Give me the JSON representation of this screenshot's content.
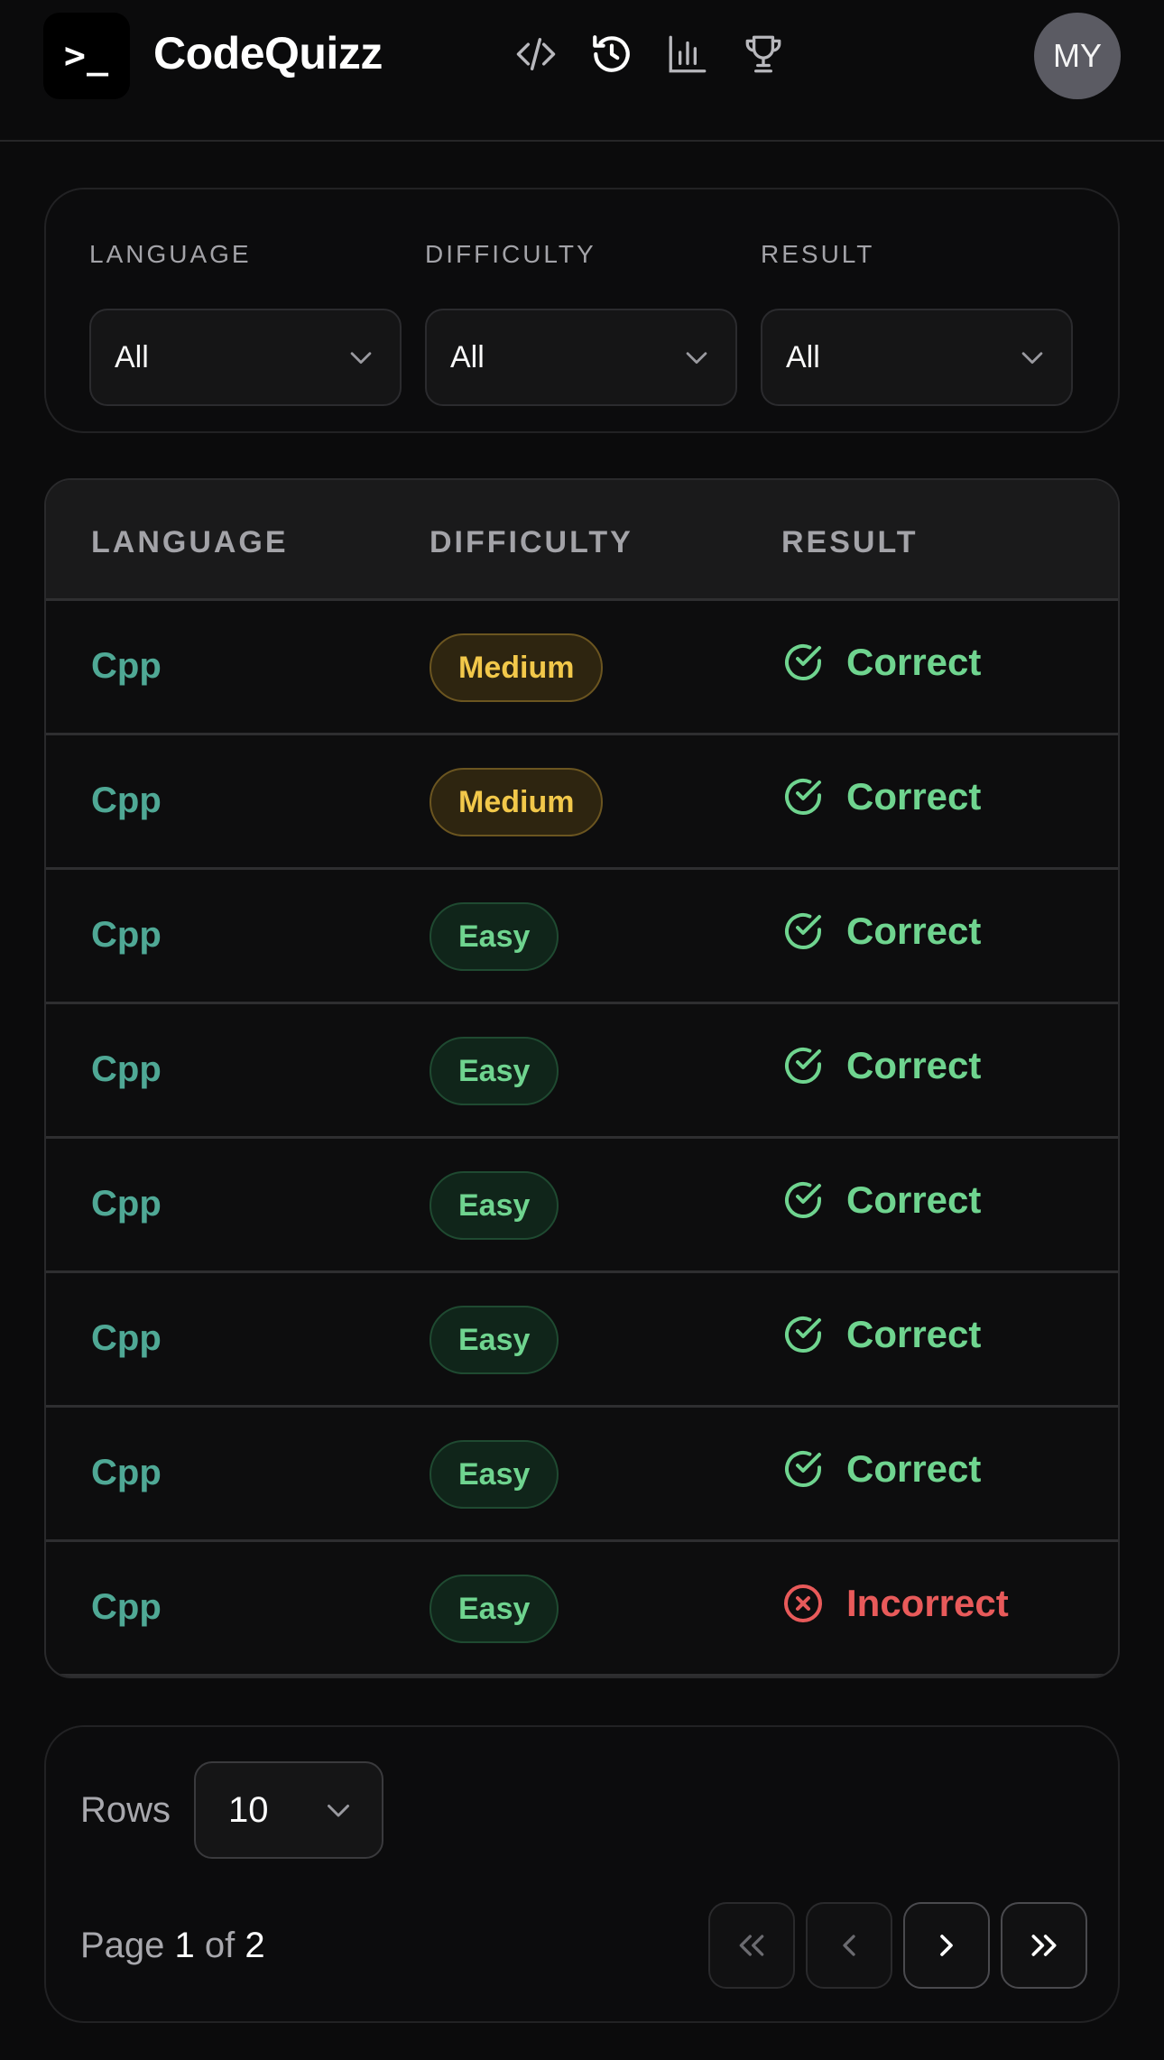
{
  "header": {
    "logo_text": ">_",
    "title": "CodeQuizz",
    "nav_icons": [
      "code-icon",
      "history-icon",
      "bar-chart-icon",
      "trophy-icon"
    ],
    "avatar_initials": "MY"
  },
  "filters": {
    "language": {
      "label": "LANGUAGE",
      "value": "All"
    },
    "difficulty": {
      "label": "DIFFICULTY",
      "value": "All"
    },
    "result": {
      "label": "RESULT",
      "value": "All"
    }
  },
  "table": {
    "columns": [
      "LANGUAGE",
      "DIFFICULTY",
      "RESULT"
    ],
    "rows": [
      {
        "language": "Cpp",
        "difficulty": "Medium",
        "result": "Correct"
      },
      {
        "language": "Cpp",
        "difficulty": "Medium",
        "result": "Correct"
      },
      {
        "language": "Cpp",
        "difficulty": "Easy",
        "result": "Correct"
      },
      {
        "language": "Cpp",
        "difficulty": "Easy",
        "result": "Correct"
      },
      {
        "language": "Cpp",
        "difficulty": "Easy",
        "result": "Correct"
      },
      {
        "language": "Cpp",
        "difficulty": "Easy",
        "result": "Correct"
      },
      {
        "language": "Cpp",
        "difficulty": "Easy",
        "result": "Correct"
      },
      {
        "language": "Cpp",
        "difficulty": "Easy",
        "result": "Incorrect"
      }
    ]
  },
  "pagination": {
    "rows_label": "Rows",
    "rows_value": "10",
    "page_word": "Page",
    "of_word": "of",
    "current_page": "1",
    "total_pages": "2"
  },
  "colors": {
    "background": "#0b0b0c",
    "language_text": "#4fa895",
    "correct": "#6fd48f",
    "incorrect": "#e85a5a",
    "medium_badge": "#f2c84a",
    "easy_badge": "#6fd48f"
  }
}
